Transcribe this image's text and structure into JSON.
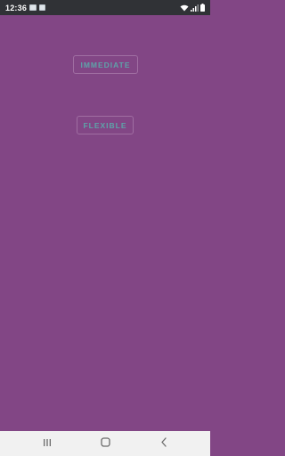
{
  "status_bar": {
    "time": "12:36",
    "notification_icons": [
      "image-notification-icon",
      "app-notification-icon"
    ],
    "system_icons": [
      "wifi-icon",
      "signal-icon",
      "battery-icon"
    ]
  },
  "main": {
    "buttons": [
      {
        "label": "IMMEDIATE"
      },
      {
        "label": "FLEXIBLE"
      }
    ]
  },
  "nav_bar": {
    "icons": [
      "recents-icon",
      "home-icon",
      "back-icon"
    ]
  },
  "colors": {
    "background": "#824685",
    "status_bar": "#303236",
    "button_text": "#5ea3a9",
    "button_border": "#a06ea2",
    "nav_bar": "#f1f1f1",
    "nav_icon": "#6b6b6b"
  }
}
